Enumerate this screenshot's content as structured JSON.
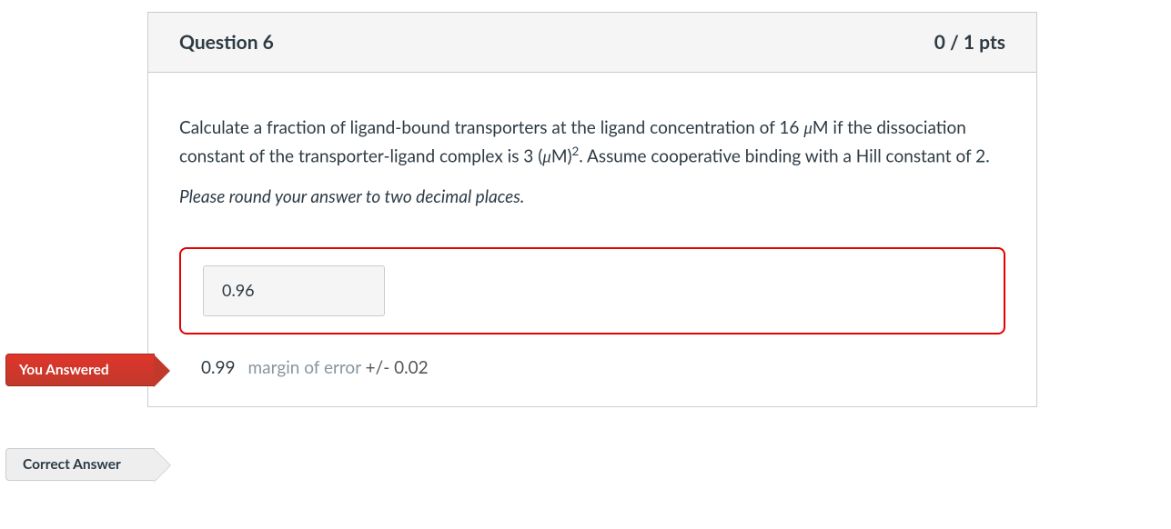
{
  "header": {
    "title": "Question 6",
    "points": "0 / 1 pts"
  },
  "question": {
    "text_html": "Calculate a fraction of ligand-bound transporters at the ligand concentration of 16 <span class=\"mu\">μ</span>M if the dissociation constant of the transporter-ligand complex is 3 (<span class=\"mu\">μ</span>M)<sup>2</sup>. Assume cooperative binding with a Hill constant of 2.",
    "instructions": "Please round your answer to two decimal places."
  },
  "your_answer": {
    "tag_label": "You Answered",
    "value": "0.96"
  },
  "correct_answer": {
    "tag_label": "Correct Answer",
    "value": "0.99",
    "margin_label": "margin of error",
    "margin_value": "+/- 0.02"
  }
}
